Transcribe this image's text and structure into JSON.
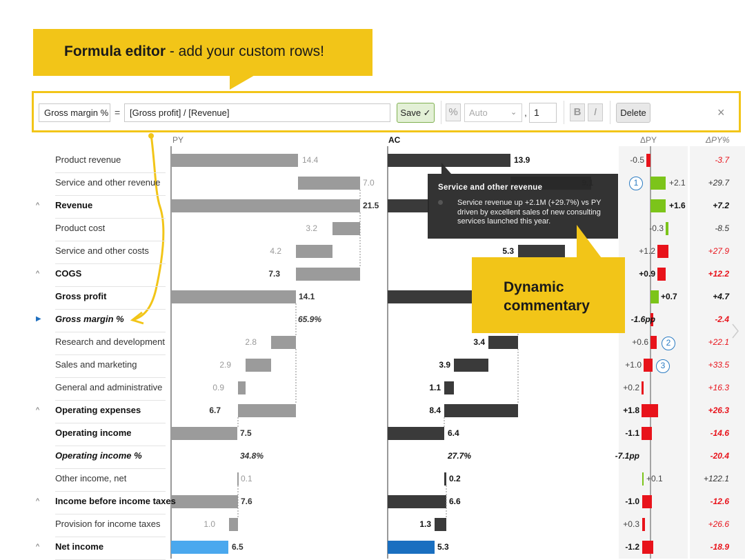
{
  "callout": {
    "title_bold": "Formula editor",
    "title_rest": " - add your custom rows!"
  },
  "toolbar": {
    "row_name": "Gross margin %",
    "equals": "=",
    "formula": "[Gross profit] / [Revenue]",
    "save_label": "Save ✓",
    "percent_label": "%",
    "format_select": "Auto",
    "comma": ",",
    "decimals": "1",
    "bold_label": "B",
    "italic_label": "I",
    "delete_label": "Delete",
    "close_label": "×"
  },
  "headers": {
    "py": "PY",
    "ac": "AC",
    "dpy": "ΔPY",
    "dpy_pct": "ΔPY%"
  },
  "rows": [
    {
      "label": "Product revenue",
      "style": "normal",
      "py": "14.4",
      "ac": "13.9",
      "dpy": "-0.5",
      "dpy_pct": "-3.7"
    },
    {
      "label": "Service and other revenue",
      "style": "normal",
      "py": "7.0",
      "ac": "9.1",
      "dpy": "+2.1",
      "dpy_pct": "+29.7"
    },
    {
      "label": "Revenue",
      "style": "bold",
      "py": "21.5",
      "ac": "",
      "dpy": "+1.6",
      "dpy_pct": "+7.2"
    },
    {
      "label": "Product cost",
      "style": "normal",
      "py": "3.2",
      "ac": "",
      "dpy": "-0.3",
      "dpy_pct": "-8.5"
    },
    {
      "label": "Service and other costs",
      "style": "normal",
      "py": "4.2",
      "ac": "5.3",
      "dpy": "+1.2",
      "dpy_pct": "+27.9"
    },
    {
      "label": "COGS",
      "style": "bold",
      "py": "7.3",
      "ac": "",
      "dpy": "+0.9",
      "dpy_pct": "+12.2"
    },
    {
      "label": "Gross profit",
      "style": "bold",
      "py": "14.1",
      "ac": "",
      "dpy": "+0.7",
      "dpy_pct": "+4.7"
    },
    {
      "label": "Gross margin %",
      "style": "bolditalic",
      "py": "65.9%",
      "ac": "",
      "dpy": "-1.6pp",
      "dpy_pct": "-2.4"
    },
    {
      "label": "Research and development",
      "style": "normal",
      "py": "2.8",
      "ac": "3.4",
      "dpy": "+0.6",
      "dpy_pct": "+22.1"
    },
    {
      "label": "Sales and marketing",
      "style": "normal",
      "py": "2.9",
      "ac": "3.9",
      "dpy": "+1.0",
      "dpy_pct": "+33.5"
    },
    {
      "label": "General and administrative",
      "style": "normal",
      "py": "0.9",
      "ac": "1.1",
      "dpy": "+0.2",
      "dpy_pct": "+16.3"
    },
    {
      "label": "Operating expenses",
      "style": "bold",
      "py": "6.7",
      "ac": "8.4",
      "dpy": "+1.8",
      "dpy_pct": "+26.3"
    },
    {
      "label": "Operating income",
      "style": "bold",
      "py": "7.5",
      "ac": "6.4",
      "dpy": "-1.1",
      "dpy_pct": "-14.6"
    },
    {
      "label": "Operating income %",
      "style": "bolditalic",
      "py": "34.8%",
      "ac": "27.7%",
      "dpy": "-7.1pp",
      "dpy_pct": "-20.4"
    },
    {
      "label": "Other income, net",
      "style": "normal",
      "py": "0.1",
      "ac": "0.2",
      "dpy": "+0.1",
      "dpy_pct": "+122.1"
    },
    {
      "label": "Income before income taxes",
      "style": "bold",
      "py": "7.6",
      "ac": "6.6",
      "dpy": "-1.0",
      "dpy_pct": "-12.6"
    },
    {
      "label": "Provision for income taxes",
      "style": "normal",
      "py": "1.0",
      "ac": "1.3",
      "dpy": "+0.3",
      "dpy_pct": "+26.6"
    },
    {
      "label": "Net income",
      "style": "bold",
      "py": "6.5",
      "ac": "5.3",
      "dpy": "-1.2",
      "dpy_pct": "-18.9"
    }
  ],
  "tooltip": {
    "title": "Service and other revenue",
    "body": "Service revenue up +2.1M (+29.7%) vs PY driven by excellent sales of new consulting services launched this year."
  },
  "commentary_callout": {
    "line1": "Dynamic",
    "line2": "commentary"
  },
  "markers": [
    "1",
    "2",
    "3"
  ],
  "colors": {
    "py_bar": "#9b9b9b",
    "ac_bar": "#3a3a3a",
    "positive": "#7cc41a",
    "negative": "#e8131b",
    "highlight_py": "#4aa8ee",
    "highlight_ac": "#1a6fc0",
    "accent": "#f2c518"
  }
}
